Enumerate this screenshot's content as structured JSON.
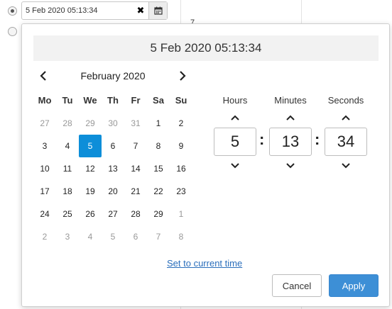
{
  "input": {
    "value": "5 Feb 2020 05:13:34",
    "clear_glyph": "✖",
    "calendar_icon": "calendar-icon"
  },
  "background": {
    "fragment": "7"
  },
  "popup": {
    "header": "5 Feb 2020 05:13:34",
    "month_label": "February 2020",
    "weekdays": [
      "Mo",
      "Tu",
      "We",
      "Th",
      "Fr",
      "Sa",
      "Su"
    ],
    "weeks": [
      [
        "27",
        "28",
        "29",
        "30",
        "31",
        "1",
        "2"
      ],
      [
        "3",
        "4",
        "5",
        "6",
        "7",
        "8",
        "9"
      ],
      [
        "10",
        "11",
        "12",
        "13",
        "14",
        "15",
        "16"
      ],
      [
        "17",
        "18",
        "19",
        "20",
        "21",
        "22",
        "23"
      ],
      [
        "24",
        "25",
        "26",
        "27",
        "28",
        "29",
        "1"
      ],
      [
        "2",
        "3",
        "4",
        "5",
        "6",
        "7",
        "8"
      ]
    ],
    "time": {
      "hours_label": "Hours",
      "minutes_label": "Minutes",
      "seconds_label": "Seconds",
      "hours": "5",
      "minutes": "13",
      "seconds": "34",
      "separator": ":"
    },
    "set_current_time": "Set to current time",
    "cancel_label": "Cancel",
    "apply_label": "Apply"
  },
  "colors": {
    "selected_day": "#0d8ed9",
    "apply_button": "#3d8fd6",
    "link": "#2a6ebb"
  }
}
